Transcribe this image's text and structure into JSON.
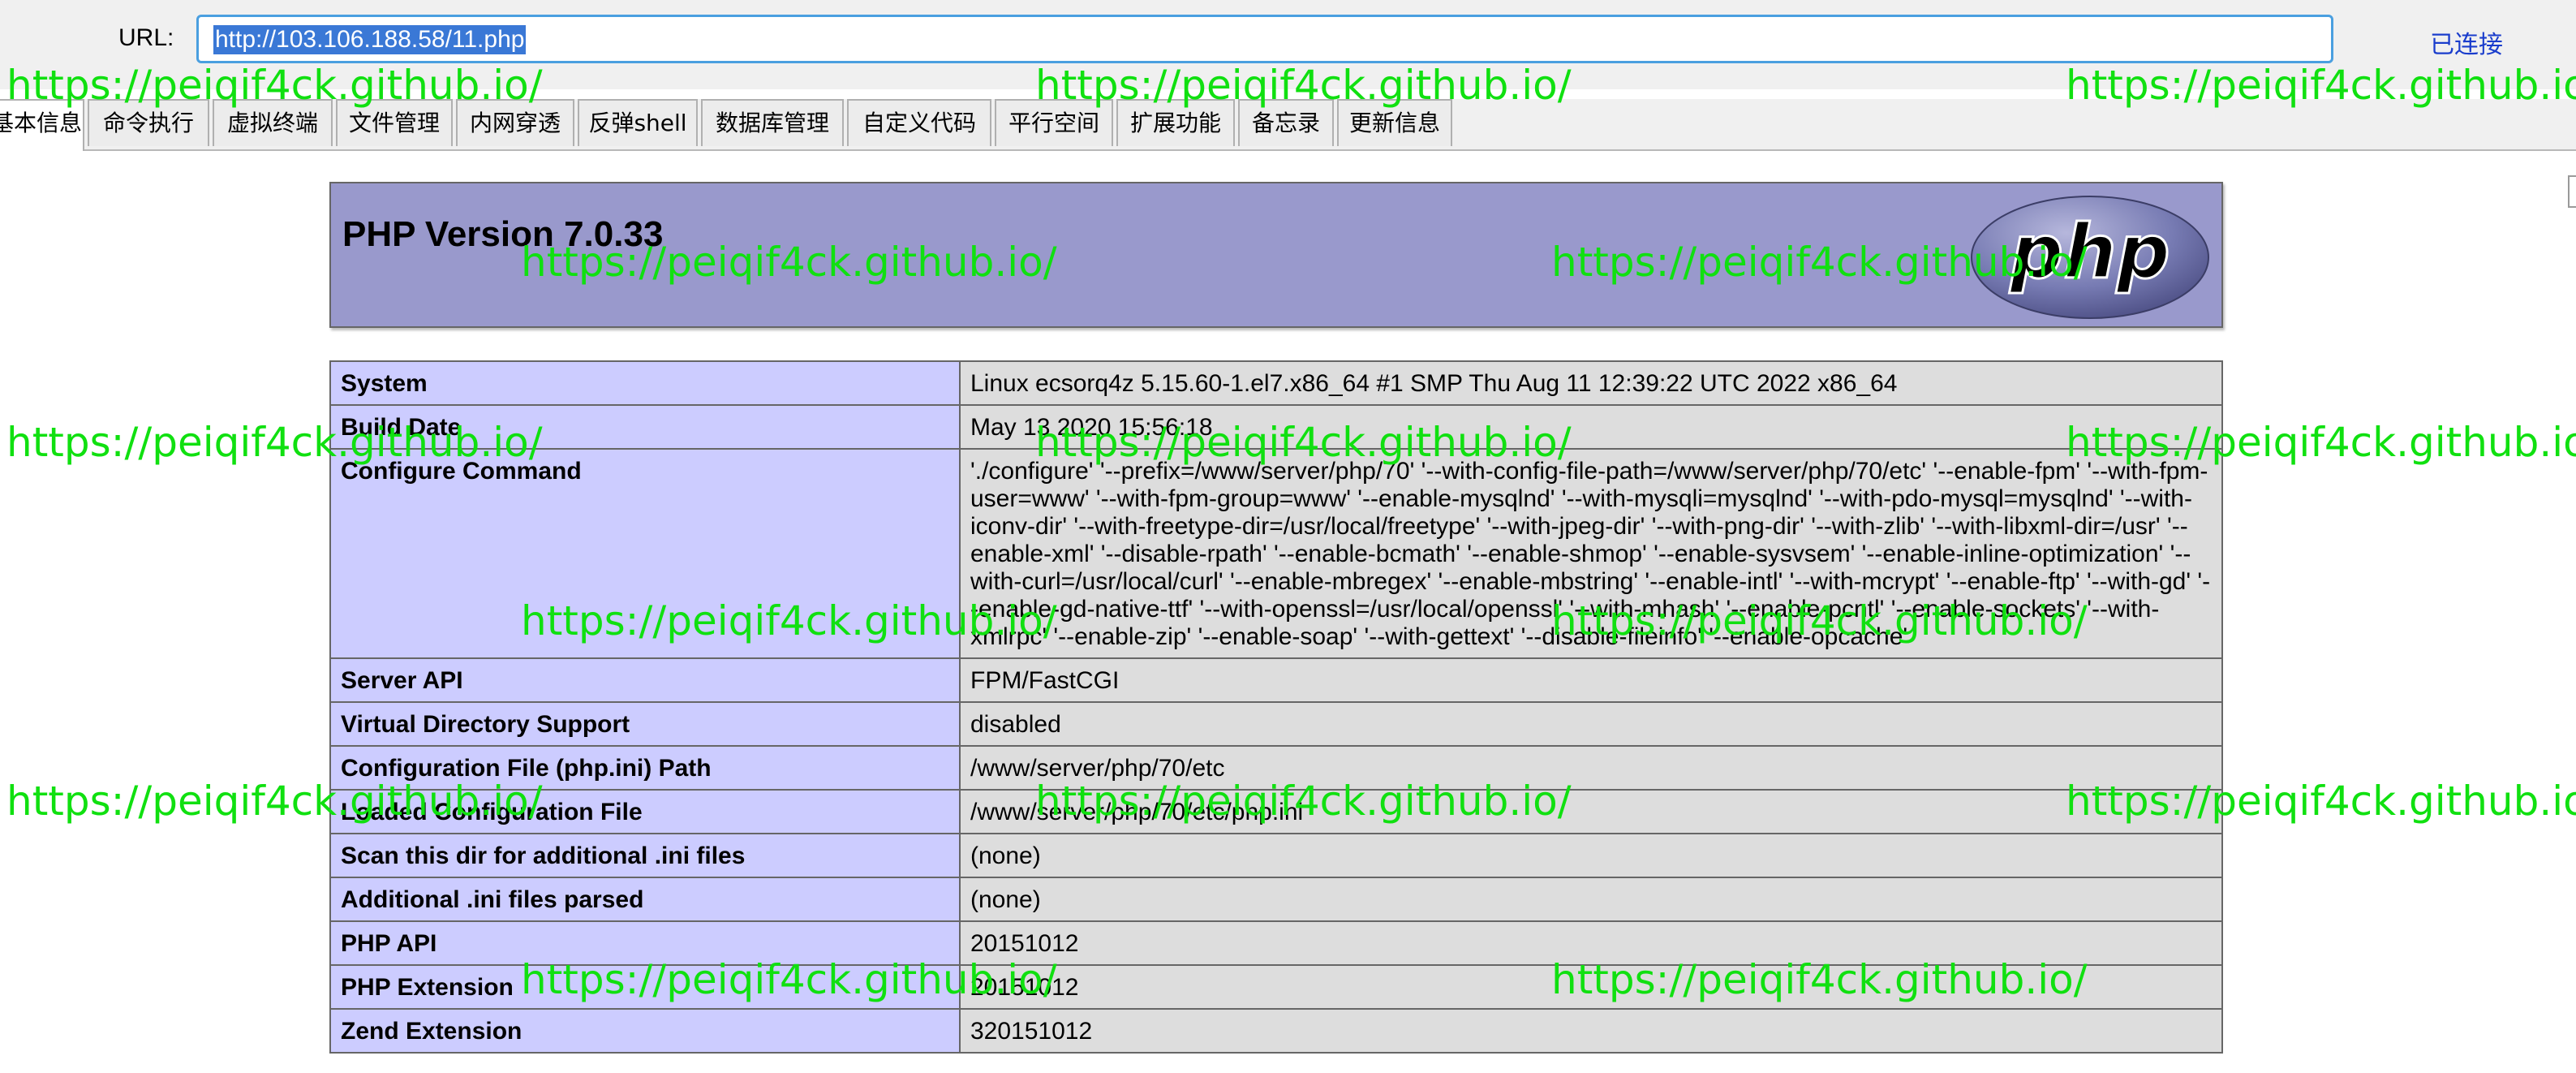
{
  "topbar": {
    "url_label": "URL:",
    "url_value": "http://103.106.188.58/11.php",
    "status": "已连接"
  },
  "tabs": [
    {
      "label": "基本信息",
      "active": true
    },
    {
      "label": "命令执行"
    },
    {
      "label": "虚拟终端"
    },
    {
      "label": "文件管理"
    },
    {
      "label": "内网穿透"
    },
    {
      "label": "反弹shell"
    },
    {
      "label": "数据库管理"
    },
    {
      "label": "自定义代码"
    },
    {
      "label": "平行空间"
    },
    {
      "label": "扩展功能"
    },
    {
      "label": "备忘录"
    },
    {
      "label": "更新信息"
    }
  ],
  "phpinfo": {
    "title": "PHP Version 7.0.33",
    "logo_text": "php",
    "rows": [
      {
        "key": "System",
        "value": "Linux ecsorq4z 5.15.60-1.el7.x86_64 #1 SMP Thu Aug 11 12:39:22 UTC 2022 x86_64"
      },
      {
        "key": "Build Date",
        "value": "May 13 2020 15:56:18"
      },
      {
        "key": "Configure Command",
        "value": "'./configure' '--prefix=/www/server/php/70' '--with-config-file-path=/www/server/php/70/etc' '--enable-fpm' '--with-fpm-user=www' '--with-fpm-group=www' '--enable-mysqlnd' '--with-mysqli=mysqlnd' '--with-pdo-mysql=mysqlnd' '--with-iconv-dir' '--with-freetype-dir=/usr/local/freetype' '--with-jpeg-dir' '--with-png-dir' '--with-zlib' '--with-libxml-dir=/usr' '--enable-xml' '--disable-rpath' '--enable-bcmath' '--enable-shmop' '--enable-sysvsem' '--enable-inline-optimization' '--with-curl=/usr/local/curl' '--enable-mbregex' '--enable-mbstring' '--enable-intl' '--with-mcrypt' '--enable-ftp' '--with-gd' '--enable-gd-native-ttf' '--with-openssl=/usr/local/openssl' '--with-mhash' '--enable-pcntl' '--enable-sockets' '--with-xmlrpc' '--enable-zip' '--enable-soap' '--with-gettext' '--disable-fileinfo' '--enable-opcache'"
      },
      {
        "key": "Server API",
        "value": "FPM/FastCGI"
      },
      {
        "key": "Virtual Directory Support",
        "value": "disabled"
      },
      {
        "key": "Configuration File (php.ini) Path",
        "value": "/www/server/php/70/etc"
      },
      {
        "key": "Loaded Configuration File",
        "value": "/www/server/php/70/etc/php.ini"
      },
      {
        "key": "Scan this dir for additional .ini files",
        "value": "(none)"
      },
      {
        "key": "Additional .ini files parsed",
        "value": "(none)"
      },
      {
        "key": "PHP API",
        "value": "20151012"
      },
      {
        "key": "PHP Extension",
        "value": "20151012"
      },
      {
        "key": "Zend Extension",
        "value": "320151012"
      }
    ]
  },
  "watermark": "https://peiqif4ck.github.io/",
  "colors": {
    "watermark": "#10e010",
    "php_header_bg": "#9999cc",
    "key_bg": "#ccccff",
    "value_bg": "#dddddd",
    "url_selection": "#3a78d6",
    "status_link": "#1a3dcc"
  }
}
